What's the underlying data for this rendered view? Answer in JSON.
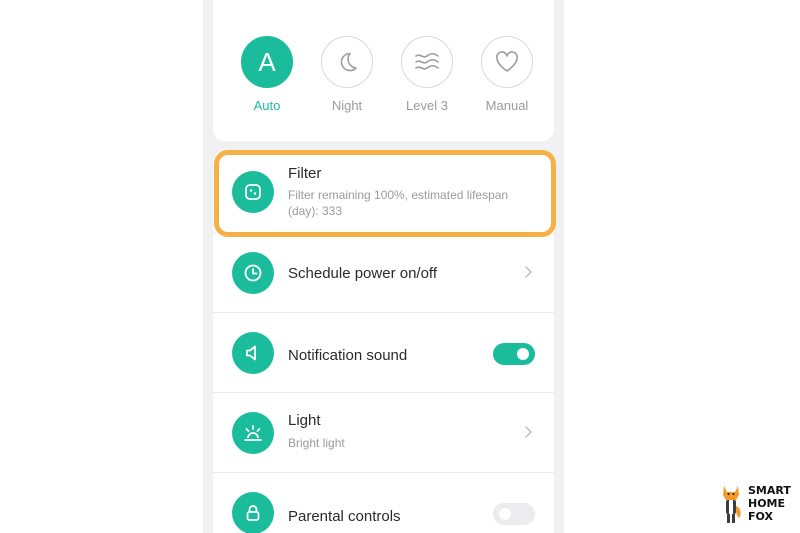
{
  "modes": [
    {
      "label": "Auto",
      "letter": "A",
      "icon": "auto-icon",
      "active": true
    },
    {
      "label": "Night",
      "icon": "moon-icon",
      "active": false
    },
    {
      "label": "Level 3",
      "icon": "wind-icon",
      "active": false
    },
    {
      "label": "Manual",
      "icon": "heart-icon",
      "active": false
    }
  ],
  "settings": {
    "filter": {
      "title": "Filter",
      "subtitle_line1": "Filter remaining 100%,  estimated lifespan",
      "subtitle_line2": "(day): 333",
      "icon": "filter-icon"
    },
    "schedule": {
      "title": "Schedule power on/off",
      "icon": "clock-icon"
    },
    "notification": {
      "title": "Notification sound",
      "icon": "speaker-icon",
      "enabled": true
    },
    "light": {
      "title": "Light",
      "subtitle": "Bright light",
      "icon": "light-icon"
    },
    "parental": {
      "title": "Parental controls",
      "icon": "lock-icon",
      "enabled": false
    }
  },
  "watermark": {
    "line1": "SMART",
    "line2": "HOME",
    "line3": "FOX",
    "icon": "fox-logo"
  },
  "colors": {
    "accent": "#1abc9c",
    "highlight": "#f6b146",
    "background": "#f1f1f3"
  }
}
